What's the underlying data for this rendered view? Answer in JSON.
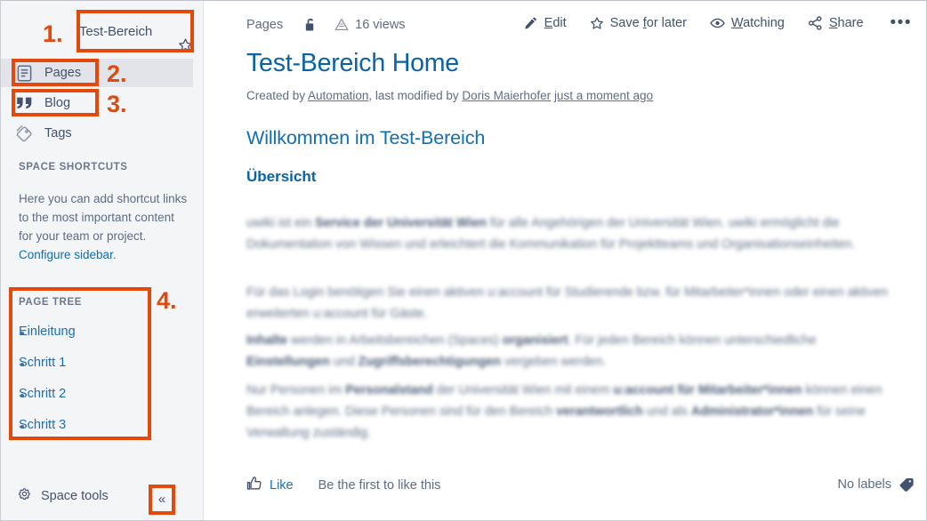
{
  "sidebar": {
    "space_title": "Test-Bereich",
    "star_icon": "star-icon",
    "nav": [
      {
        "label": "Pages",
        "icon": "pages-icon",
        "active": true
      },
      {
        "label": "Blog",
        "icon": "blog-quote-icon",
        "active": false
      },
      {
        "label": "Tags",
        "icon": "tags-icon",
        "active": false
      }
    ],
    "shortcuts_heading": "SPACE SHORTCUTS",
    "shortcuts_text_before": "Here you can add shortcut links to the most important content for your team or project. ",
    "shortcuts_link": "Configure sidebar",
    "shortcuts_text_after": ".",
    "page_tree_heading": "PAGE TREE",
    "page_tree": [
      {
        "label": "Einleitung"
      },
      {
        "label": "Schritt 1"
      },
      {
        "label": "Schritt 2"
      },
      {
        "label": "Schritt 3"
      }
    ],
    "space_tools_label": "Space tools",
    "space_tools_icon": "gear-icon",
    "collapse_label": "«",
    "collapse_icon": "chevron-double-left-icon"
  },
  "toolbar": {
    "breadcrumb": "Pages",
    "restrictions_icon": "unlocked-padlock-icon",
    "analytics_icon": "analytics-icon",
    "views_label": "16 views",
    "buttons": [
      {
        "label_pre": "",
        "label_key": "E",
        "label_post": "dit",
        "icon": "pencil-icon",
        "name": "edit-button"
      },
      {
        "label_pre": "Save ",
        "label_key": "f",
        "label_post": "or later",
        "icon": "star-icon",
        "name": "save-for-later-button"
      },
      {
        "label_pre": "",
        "label_key": "W",
        "label_post": "atching",
        "icon": "eye-icon",
        "name": "watching-button"
      },
      {
        "label_pre": "",
        "label_key": "S",
        "label_post": "hare",
        "icon": "share-icon",
        "name": "share-button"
      }
    ],
    "more_label": "•••",
    "more_icon": "ellipsis-icon"
  },
  "page": {
    "title": "Test-Bereich Home",
    "byline_created": "Created by ",
    "byline_author": "Automation",
    "byline_mid": ", last modified by ",
    "byline_modifier": "Doris Maierhofer",
    "byline_time": "just a moment ago",
    "heading_1": "Willkommen im Test-Bereich",
    "heading_2": "Übersicht",
    "paragraphs": [
      {
        "id": "p1",
        "parts": [
          {
            "t": "uwiki ist ein ",
            "b": false
          },
          {
            "t": "Service der Universität Wien",
            "b": true
          },
          {
            "t": " für alle Angehörigen der Universität Wien. uwiki ermöglicht die Dokumentation von Wissen und erleichtert die Kommunikation für Projektteams und Organisationseinheiten.",
            "b": false
          }
        ]
      },
      {
        "id": "p2",
        "parts": [
          {
            "t": "Für das Login benötigen Sie einen aktiven u:account für Studierende bzw. für Mitarbeiter*innen oder einen aktiven erweiterten u:account für Gäste.",
            "b": false
          }
        ]
      },
      {
        "id": "p3",
        "parts": [
          {
            "t": "Inhalte",
            "b": true
          },
          {
            "t": " werden in Arbeitsbereichen (Spaces) ",
            "b": false
          },
          {
            "t": "organisiert",
            "b": true
          },
          {
            "t": ". Für jeden Bereich können unterschiedliche ",
            "b": false
          },
          {
            "t": "Einstellungen",
            "b": true
          },
          {
            "t": " und ",
            "b": false
          },
          {
            "t": "Zugriffsberechtigungen",
            "b": true
          },
          {
            "t": " vergeben werden.",
            "b": false
          }
        ]
      },
      {
        "id": "p4",
        "parts": [
          {
            "t": "Nur Personen im ",
            "b": false
          },
          {
            "t": "Personalstand",
            "b": true
          },
          {
            "t": " der Universität Wien mit einem ",
            "b": false
          },
          {
            "t": "u:account für Mitarbeiter*innen",
            "b": true
          },
          {
            "t": " können einen Bereich anlegen. Diese Personen sind für den Bereich ",
            "b": false
          },
          {
            "t": "verantwortlich",
            "b": true
          },
          {
            "t": " und als ",
            "b": false
          },
          {
            "t": "Administrator*innen",
            "b": true
          },
          {
            "t": " für seine Verwaltung zuständig.",
            "b": false
          }
        ]
      }
    ]
  },
  "footer": {
    "like_label": "Like",
    "like_icon": "thumbs-up-icon",
    "like_hint": "Be the first to like this",
    "labels_text": "No labels",
    "labels_icon": "tag-icon"
  },
  "annotations": {
    "color": "#e4490c",
    "markers": [
      {
        "id": "1",
        "label": "1.",
        "target": "space-title-box"
      },
      {
        "id": "2",
        "label": "2.",
        "target": "pages-nav-box"
      },
      {
        "id": "3",
        "label": "3.",
        "target": "blog-nav-box"
      },
      {
        "id": "4",
        "label": "4.",
        "target": "page-tree-box"
      }
    ]
  }
}
